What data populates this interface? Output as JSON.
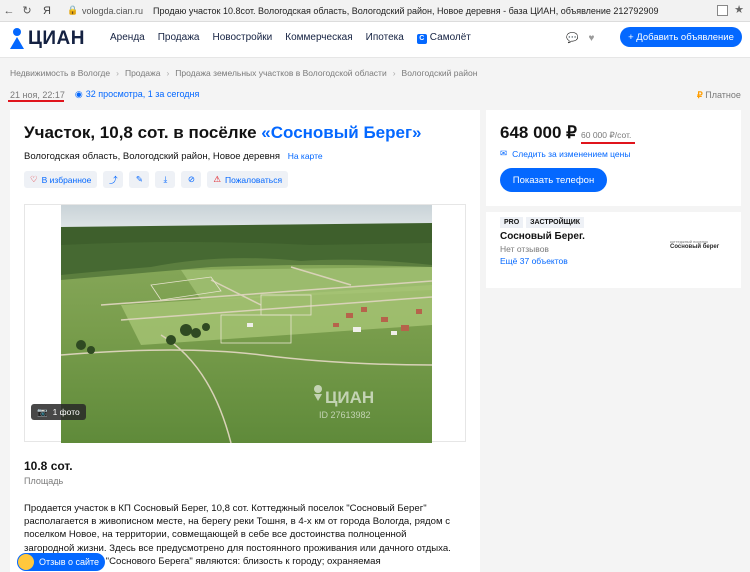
{
  "browser": {
    "domain": "vologda.cian.ru",
    "title": "Продаю участок 10.8сот. Вологодская область, Вологодский район, Новое деревня - база ЦИАН, объявление 212792909",
    "ya": "Я"
  },
  "header": {
    "logo": "ЦИАН",
    "nav": [
      "Аренда",
      "Продажа",
      "Новостройки",
      "Коммерческая",
      "Ипотека",
      "Самолёт"
    ],
    "add_button": "+ Добавить объявление"
  },
  "breadcrumb": [
    "Недвижимость в Вологде",
    "Продажа",
    "Продажа земельных участков в Вологодской области",
    "Вологодский район"
  ],
  "meta": {
    "date": "21 ноя, 22:17",
    "views": "32 просмотра, 1 за сегодня",
    "paid": "Платное"
  },
  "listing": {
    "title_prefix": "Участок, 10,8 сот. в посёлке ",
    "title_link": "«Сосновый Берег»",
    "address": "Вологодская область, Вологодский район, Новое деревня",
    "on_map": "На карте",
    "actions": {
      "favorite": "В избранное",
      "report": "Пожаловаться"
    },
    "photo_count": "1 фото",
    "watermark_brand": "ЦИАН",
    "watermark_id": "ID 27613982",
    "area_value": "10.8 сот.",
    "area_label": "Площадь",
    "description": "Продается участок в КП Сосновый Берег, 10,8 сот. Коттеджный поселок \"Сосновый Берег\" располагается в живописном месте, на берегу реки Тошня, в 4-х км от города Вологда, рядом с поселком Новое, на территории, совмещающей в себе все достоинства полноценной загородной жизни. Здесь все предусмотрено для постоянного проживания или дачного отдыха. Преимуществами \"Соснового Берега\" являются: близость к городу; охраняемая"
  },
  "sidebar": {
    "price": "648 000 ₽",
    "price_per_unit": "60 000 ₽/сот.",
    "subscribe": "Следить за изменением цены",
    "show_phone": "Показать телефон"
  },
  "developer": {
    "badge_pro": "PRO",
    "badge_type": "ЗАСТРОЙЩИК",
    "name": "Сосновый Берег.",
    "reviews": "Нет отзывов",
    "more": "Ещё 37 объектов",
    "logo_small": "коттеджный поселок",
    "logo_big": "Сосновый берег"
  },
  "chat": {
    "label": "Отзыв о сайте"
  },
  "colors": {
    "accent": "#0468ff",
    "highlight": "#e0141c",
    "paid": "#ff9d00"
  },
  "icons": [
    "back-arrow-icon",
    "refresh-icon",
    "lock-icon",
    "heart-icon",
    "share-icon",
    "edit-icon",
    "download-icon",
    "hide-icon",
    "warning-icon",
    "camera-icon",
    "mail-icon",
    "eye-icon",
    "chat-icon",
    "bell-icon"
  ]
}
